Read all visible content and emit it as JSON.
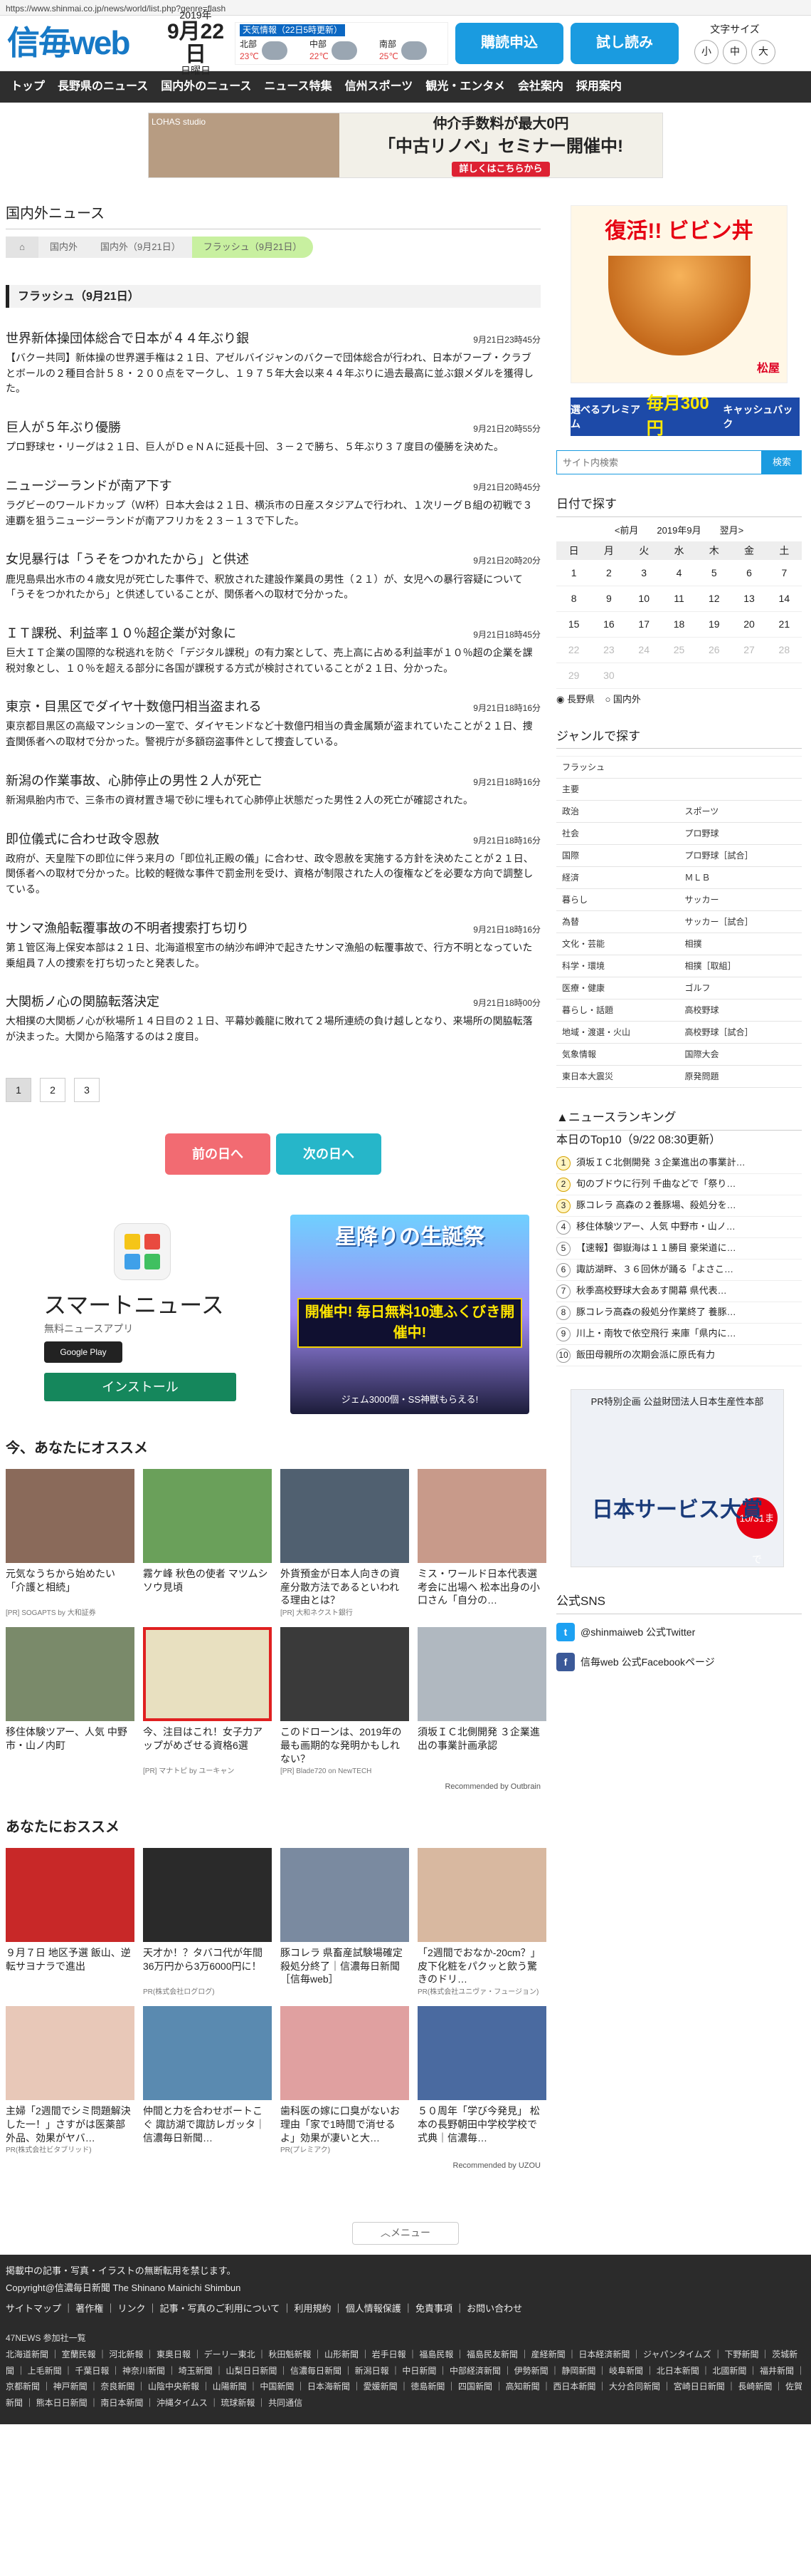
{
  "url": "https://www.shinmai.co.jp/news/world/list.php?genre=flash",
  "header": {
    "logo": "信毎web",
    "year": "2019年",
    "date": "9月22日",
    "weekday": "日曜日",
    "weather_title": "天気情報（22日5時更新）",
    "weather": [
      {
        "area": "北部",
        "temp": "23℃"
      },
      {
        "area": "中部",
        "temp": "22℃"
      },
      {
        "area": "南部",
        "temp": "25℃"
      }
    ],
    "subscribe_btn": "購読申込",
    "trial_btn": "試し読み",
    "fontsize_label": "文字サイズ",
    "fontsize_options": [
      "小",
      "中",
      "大"
    ]
  },
  "nav": [
    "トップ",
    "長野県のニュース",
    "国内外のニュース",
    "ニュース特集",
    "信州スポーツ",
    "観光・エンタメ",
    "会社案内",
    "採用案内"
  ],
  "top_ad": {
    "brand": "LOHAS studio",
    "tag": "今なら",
    "line1": "仲介手数料が最大0円",
    "line2": "「中古リノベ」セミナー開催中!",
    "cta": "詳しくはこちらから"
  },
  "page_title": "国内外ニュース",
  "breadcrumb": [
    "国内外",
    "国内外（9月21日）",
    "フラッシュ（9月21日）"
  ],
  "category": "フラッシュ（9月21日）",
  "articles": [
    {
      "title": "世界新体操団体総合で日本が４４年ぶり銀",
      "time": "9月21日23時45分",
      "body": "【バクー共同】新体操の世界選手権は２１日、アゼルバイジャンのバクーで団体総合が行われ、日本がフープ・クラブとボールの２種目合計５８・２００点をマークし、１９７５年大会以来４４年ぶりに過去最高に並ぶ銀メダルを獲得した。"
    },
    {
      "title": "巨人が５年ぶり優勝",
      "time": "9月21日20時55分",
      "body": "プロ野球セ・リーグは２１日、巨人がＤｅＮＡに延長十回、３－２で勝ち、５年ぶり３７度目の優勝を決めた。"
    },
    {
      "title": "ニュージーランドが南ア下す",
      "time": "9月21日20時45分",
      "body": "ラグビーのワールドカップ（Ｗ杯）日本大会は２１日、横浜市の日産スタジアムで行われ、１次リーグＢ組の初戦で３連覇を狙うニュージーランドが南アフリカを２３－１３で下した。"
    },
    {
      "title": "女児暴行は「うそをつかれたから」と供述",
      "time": "9月21日20時20分",
      "body": "鹿児島県出水市の４歳女児が死亡した事件で、釈放された建設作業員の男性（２１）が、女児への暴行容疑について「うそをつかれたから」と供述していることが、関係者への取材で分かった。"
    },
    {
      "title": "ＩＴ課税、利益率１０％超企業が対象に",
      "time": "9月21日18時45分",
      "body": "巨大ＩＴ企業の国際的な税逃れを防ぐ「デジタル課税」の有力案として、売上高に占める利益率が１０％超の企業を課税対象とし、１０％を超える部分に各国が課税する方式が検討されていることが２１日、分かった。"
    },
    {
      "title": "東京・目黒区でダイヤ十数億円相当盗まれる",
      "time": "9月21日18時16分",
      "body": "東京都目黒区の高級マンションの一室で、ダイヤモンドなど十数億円相当の貴金属類が盗まれていたことが２１日、捜査関係者への取材で分かった。警視庁が多額窃盗事件として捜査している。"
    },
    {
      "title": "新潟の作業事故、心肺停止の男性２人が死亡",
      "time": "9月21日18時16分",
      "body": "新潟県胎内市で、三条市の資材置き場で砂に埋もれて心肺停止状態だった男性２人の死亡が確認された。"
    },
    {
      "title": "即位儀式に合わせ政令恩赦",
      "time": "9月21日18時16分",
      "body": "政府が、天皇陛下の即位に伴う来月の「即位礼正殿の儀」に合わせ、政令恩赦を実施する方針を決めたことが２１日、関係者への取材で分かった。比較的軽微な事件で罰金刑を受け、資格が制限された人の復権などを必要な方向で調整している。"
    },
    {
      "title": "サンマ漁船転覆事故の不明者捜索打ち切り",
      "time": "9月21日18時16分",
      "body": "第１管区海上保安本部は２１日、北海道根室市の納沙布岬沖で起きたサンマ漁船の転覆事故で、行方不明となっていた乗組員７人の捜索を打ち切ったと発表した。"
    },
    {
      "title": "大関栃ノ心の関脇転落決定",
      "time": "9月21日18時00分",
      "body": "大相撲の大関栃ノ心が秋場所１４日目の２１日、平幕妙義龍に敗れて２場所連続の負け越しとなり、来場所の関脇転落が決まった。大関から陥落するのは２度目。"
    }
  ],
  "pager": [
    "1",
    "2",
    "3"
  ],
  "prev_btn": "前の日へ",
  "next_btn": "次の日へ",
  "smartnews": {
    "title": "スマートニュース",
    "sub": "無料ニュースアプリ",
    "store": "Google Play",
    "install": "インストール"
  },
  "game_ad": {
    "title": "星降りの生誕祭",
    "banner": "開催中! 毎日無料10連ふくびき開催中!",
    "note": "ジェム3000個・SS神獣もらえる!"
  },
  "rec_title": "今、あなたにオススメ",
  "rec_items": [
    {
      "cap": "元気なうちから始めたい「介護と相続」",
      "pr": "[PR] SOGAPTS by 大和証券"
    },
    {
      "cap": "霧ケ峰 秋色の使者 マツムシソウ見頃",
      "pr": ""
    },
    {
      "cap": "外貨預金が日本人向きの資産分散方法であるといわれる理由とは？",
      "pr": "[PR] 大和ネクスト銀行"
    },
    {
      "cap": "ミス・ワールド日本代表選考会に出場へ 松本出身の小口さん「自分の…",
      "pr": ""
    },
    {
      "cap": "移住体験ツアー、人気 中野市・山ノ内町",
      "pr": ""
    },
    {
      "cap": "今、注目はこれ！女子力アップがめざせる資格6選",
      "pr": "[PR] マナトピ by ユーキャン"
    },
    {
      "cap": "このドローンは、2019年の最も画期的な発明かもしれない？",
      "pr": "[PR] Blade720 on NewTECH"
    },
    {
      "cap": "須坂ＩＣ北側開発 ３企業進出の事業計画承認",
      "pr": ""
    }
  ],
  "rec_by": "Recommended by Outbrain",
  "rec2_title": "あなたにおススメ",
  "rec2_items": [
    {
      "cap": "９月７日 地区予選 飯山、逆転サヨナラで進出",
      "pr": ""
    },
    {
      "cap": "天才か！？タバコ代が年間36万円から3万6000円に！",
      "pr": "PR(株式会社ログログ)"
    },
    {
      "cap": "豚コレラ 県畜産試験場確定 殺処分終了｜信濃毎日新聞［信毎web］",
      "pr": ""
    },
    {
      "cap": "「2週間でおなか-20cm？」 皮下化粧をパクッと飲う驚きのドリ…",
      "pr": "PR(株式会社ユニヴァ・フュージョン)"
    },
    {
      "cap": "主婦「2週間でシミ問題解決した一！」さすがは医薬部外品、効果がヤバ…",
      "pr": "PR(株式会社ビタブリッド)"
    },
    {
      "cap": "仲間と力を合わせボートこぐ 諏訪湖で諏訪レガッタ｜信濃毎日新聞…",
      "pr": ""
    },
    {
      "cap": "歯科医の嫁に口臭がないお理由「家で1時間で消せるよ」効果が凄いと大…",
      "pr": "PR(プレミアク)"
    },
    {
      "cap": "５０周年「学び今発見」 松本の長野朝田中学校学校で式典｜信濃毎…",
      "pr": ""
    }
  ],
  "rec2_by": "Recommended by UZOU",
  "menu_btn": "メニュー",
  "footer": {
    "copy1": "掲載中の記事・写真・イラストの無断転用を禁じます。",
    "copy2": "Copyright@信濃毎日新聞 The Shinano Mainichi Shimbun",
    "links": "サイトマップ ｜ 著作権 ｜ リンク ｜ 記事・写真のご利用について ｜ 利用規約 ｜ 個人情報保護 ｜ 免責事項 ｜ お問い合わせ",
    "news_label": "47NEWS 参加社一覧",
    "news": "北海道新聞 ｜ 室蘭民報 ｜ 河北新報 ｜ 東奥日報 ｜ デーリー東北 ｜ 秋田魁新報 ｜ 山形新聞 ｜ 岩手日報 ｜ 福島民報 ｜ 福島民友新聞 ｜ 産経新聞 ｜ 日本経済新聞 ｜ ジャパンタイムズ ｜ 下野新聞 ｜ 茨城新聞 ｜ 上毛新聞 ｜ 千葉日報 ｜ 神奈川新聞 ｜ 埼玉新聞 ｜ 山梨日日新聞 ｜ 信濃毎日新聞 ｜ 新潟日報 ｜ 中日新聞 ｜ 中部経済新聞 ｜ 伊勢新聞 ｜ 静岡新聞 ｜ 岐阜新聞 ｜ 北日本新聞 ｜ 北國新聞 ｜ 福井新聞 ｜ 京都新聞 ｜ 神戸新聞 ｜ 奈良新聞 ｜ 山陰中央新報 ｜ 山陽新聞 ｜ 中国新聞 ｜ 日本海新聞 ｜ 愛媛新聞 ｜ 徳島新聞 ｜ 四国新聞 ｜ 高知新聞 ｜ 西日本新聞 ｜ 大分合同新聞 ｜ 宮崎日日新聞 ｜ 長崎新聞 ｜ 佐賀新聞 ｜ 熊本日日新聞 ｜ 南日本新聞 ｜ 沖縄タイムス ｜ 琉球新報 ｜ 共同通信"
  },
  "side": {
    "ad1": {
      "title": "復活!! ビビン丼",
      "brand": "松屋"
    },
    "ad2": {
      "l": "選べるプレミアム",
      "m": "毎月300円",
      "r": "キャッシュバック"
    },
    "search_ph": "サイト内検索",
    "search_btn": "検索",
    "date_title": "日付で探す",
    "cal_prev": "<前月",
    "cal_month": "2019年9月",
    "cal_next": "翌月>",
    "weekdays": [
      "日",
      "月",
      "火",
      "水",
      "木",
      "金",
      "土"
    ],
    "radio1": "長野県",
    "radio2": "国内外",
    "genre_title": "ジャンルで探す",
    "genres": [
      "フラッシュ",
      "主要",
      "政治",
      "スポーツ",
      "社会",
      "プロ野球",
      "国際",
      "プロ野球［試合］",
      "経済",
      "ＭＬＢ",
      "暮らし",
      "サッカー",
      "為替",
      "サッカー［試合］",
      "文化・芸能",
      "相撲",
      "科学・環境",
      "相撲［取組］",
      "医療・健康",
      "ゴルフ",
      "暮らし・話題",
      "高校野球",
      "地域・渡選・火山",
      "高校野球［試合］",
      "気象情報",
      "国際大会",
      "東日本大震災",
      "原発問題"
    ],
    "ranking_title": "ニュースランキング",
    "ranking_sub": "本日のTop10（9/22 08:30更新）",
    "ranking": [
      "須坂ＩＣ北側開発 ３企業進出の事業計…",
      "旬のブドウに行列 千曲などで「祭り…",
      "豚コレラ 高森の２養豚場、殺処分を…",
      "移住体験ツアー、人気 中野市・山ノ…",
      "【速報】御嶽海は１１勝目 豪栄道に…",
      "諏訪湖畔、３６回休が踊る「よさこ…",
      "秋季高校野球大会あす開幕 県代表…",
      "豚コレラ高森の殺処分作業終了 養豚…",
      "川上・南牧で依空飛行 来庫「県内に…",
      "飯田母親所の次期会派に原氏有力"
    ],
    "ad3": {
      "top": "PR特別企画 公益財団法人日本生産性本部",
      "big": "日本サービス大賞",
      "badge": "10/31まで"
    },
    "sns_title": "公式SNS",
    "twitter": "@shinmaiweb 公式Twitter",
    "facebook": "信毎web 公式Facebookページ"
  }
}
